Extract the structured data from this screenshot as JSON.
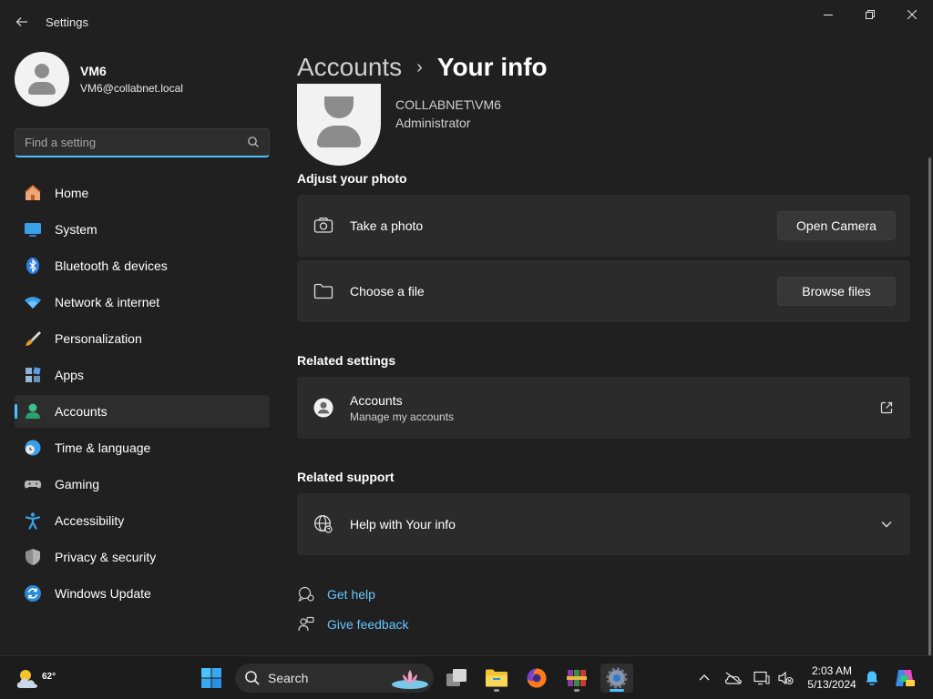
{
  "window": {
    "title": "Settings",
    "controls": {
      "minimize": "minimize",
      "restore": "restore",
      "close": "close"
    }
  },
  "profile": {
    "name": "VM6",
    "email": "VM6@collabnet.local"
  },
  "search": {
    "placeholder": "Find a setting",
    "value": ""
  },
  "sidebar": {
    "items": [
      {
        "label": "Home",
        "icon": "home-icon"
      },
      {
        "label": "System",
        "icon": "monitor-icon"
      },
      {
        "label": "Bluetooth & devices",
        "icon": "bluetooth-icon"
      },
      {
        "label": "Network & internet",
        "icon": "wifi-icon"
      },
      {
        "label": "Personalization",
        "icon": "brush-icon"
      },
      {
        "label": "Apps",
        "icon": "apps-icon"
      },
      {
        "label": "Accounts",
        "icon": "person-icon",
        "active": true
      },
      {
        "label": "Time & language",
        "icon": "globe-clock-icon"
      },
      {
        "label": "Gaming",
        "icon": "controller-icon"
      },
      {
        "label": "Accessibility",
        "icon": "accessibility-icon"
      },
      {
        "label": "Privacy & security",
        "icon": "shield-icon"
      },
      {
        "label": "Windows Update",
        "icon": "update-icon"
      }
    ]
  },
  "main": {
    "breadcrumb": {
      "parent": "Accounts",
      "separator": "›",
      "current": "Your info"
    },
    "account": {
      "domain_user": "COLLABNET\\VM6",
      "role": "Administrator"
    },
    "adjust_photo": {
      "title": "Adjust your photo",
      "take_photo": {
        "label": "Take a photo",
        "button": "Open Camera"
      },
      "choose_file": {
        "label": "Choose a file",
        "button": "Browse files"
      }
    },
    "related_settings": {
      "title": "Related settings",
      "accounts": {
        "label": "Accounts",
        "sublabel": "Manage my accounts"
      }
    },
    "related_support": {
      "title": "Related support",
      "help": {
        "label": "Help with Your info"
      }
    },
    "links": {
      "get_help": "Get help",
      "give_feedback": "Give feedback"
    }
  },
  "taskbar": {
    "weather_temp": "62°",
    "search_label": "Search",
    "time": "2:03 AM",
    "date": "5/13/2024"
  },
  "colors": {
    "accent": "#4cc2ff",
    "link": "#69c5ff",
    "background": "#202020",
    "card": "#2b2b2b"
  }
}
